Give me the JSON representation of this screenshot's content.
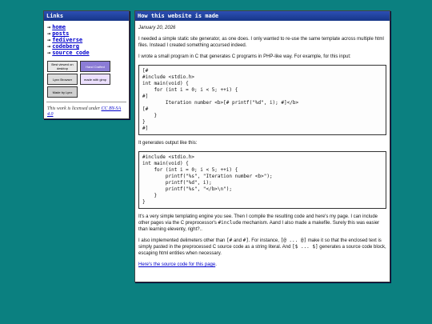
{
  "links": {
    "title": "Links",
    "items": [
      {
        "label": "home"
      },
      {
        "label": "posts"
      },
      {
        "label": "fediverse"
      },
      {
        "label": "codeberg"
      },
      {
        "label": "source code"
      }
    ],
    "badges": [
      {
        "text": "Best viewed on desktop"
      },
      {
        "text": "Hand Crafted"
      },
      {
        "text": "Lynx Browser"
      },
      {
        "text": "made with gimp"
      },
      {
        "text": "Made by Lynx"
      }
    ],
    "license_prefix": "This work is licensed under ",
    "license_link": "CC BY-SA 4.0"
  },
  "article": {
    "title": "How this website is made",
    "date": "January 20, 2026",
    "p1": "I needed a simple static site generator, as one does. I only wanted to re-use the same template across multiple html files. Instead I created something accursed indeed.",
    "p2": "I wrote a small program in C that generates C programs in PHP-like way. For example, for this input:",
    "code1": "[#\n#include <stdio.h>\nint main(void) {\n    for (int i = 0; i < 5; ++i) {\n#]\n        Iteration number <b>[# printf(\"%d\", i); #]</b>\n[#\n    }\n}\n#]",
    "p3": "It generates output like this:",
    "code2": "#include <stdio.h>\nint main(void) {\n    for (int i = 0; i < 5; ++i) {\n        printf(\"%s\", \"Iteration number <b>\");\n        printf(\"%d\", i);\n        printf(\"%s\", \"</b>\\n\");\n    }\n}",
    "p4a": "It's a very simple templating engine you see. Then I compile the resulting code and here's my page. I can include other pages via the C preprocessor's ",
    "p4code": "#include",
    "p4b": " mechanism. Aand I also made a makefile. Surely this was easier than learning eleventy, right?..",
    "p5a": "I also implemented delimeters other than ",
    "p5c1": "[#",
    "p5and": " and ",
    "p5c2": "#]",
    "p5b": ". For instance, ",
    "p5c3": "[@ ... @]",
    "p5c": " make it so that the enclosed text is simply pasted in the preprocessed C source code as a string literal. And ",
    "p5c4": "[$ ... $]",
    "p5d": " generates a source code block, escaping html entities when necessary.",
    "source_link": "Here's the source code for this page"
  }
}
